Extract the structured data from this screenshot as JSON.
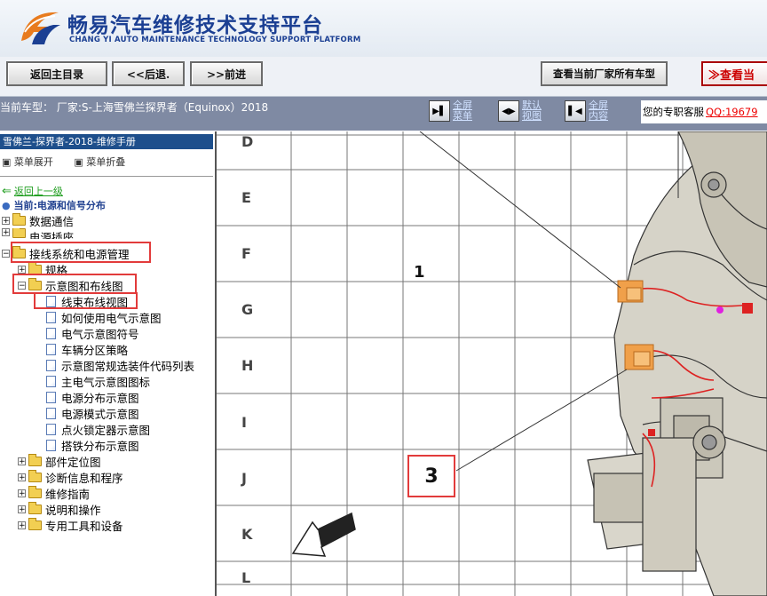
{
  "header": {
    "title": "畅易汽车维修技术支持平台",
    "subtitle": "CHANG YI AUTO MAINTENANCE TECHNOLOGY SUPPORT PLATFORM",
    "brand_color": "#1b3f93"
  },
  "toolbar": {
    "back_main": "返回主目录",
    "back": "<<后退.",
    "forward": ">>前进",
    "view_all_models": "查看当前厂家所有车型",
    "view_current": "≫查看当"
  },
  "infobar": {
    "current_model": "当前车型： 厂家:S-上海雪佛兰探界者（Equinox）2018",
    "view_buttons": [
      {
        "label_line1": "全屏",
        "label_line2": "菜单",
        "icon": "fullscreen-menu-icon"
      },
      {
        "label_line1": "默认",
        "label_line2": "视图",
        "icon": "default-view-icon"
      },
      {
        "label_line1": "全屏",
        "label_line2": "内容",
        "icon": "fullscreen-content-icon"
      }
    ],
    "support_label": "您的专职客服",
    "support_qq": "QQ:19679"
  },
  "sidebar": {
    "manual_title": "雪佛兰-探界者-2018-维修手册",
    "expand_menu": "菜单展开",
    "collapse_menu": "菜单折叠",
    "back_up": "返回上一级",
    "current_location": "当前:电源和信号分布",
    "tree": [
      {
        "label": "数据通信",
        "type": "folder",
        "level": 0,
        "expanded": false
      },
      {
        "label": "电源插座",
        "type": "folder",
        "level": 0,
        "expanded": false
      },
      {
        "label": "接线系统和电源管理",
        "type": "folder",
        "level": 0,
        "expanded": true,
        "highlighted": true
      },
      {
        "label": "规格",
        "type": "folder",
        "level": 1,
        "expanded": false
      },
      {
        "label": "示意图和布线图",
        "type": "folder",
        "level": 1,
        "expanded": true,
        "highlighted": true
      },
      {
        "label": "线束布线视图",
        "type": "doc",
        "level": 2,
        "highlighted": true
      },
      {
        "label": "如何使用电气示意图",
        "type": "doc",
        "level": 2
      },
      {
        "label": "电气示意图符号",
        "type": "doc",
        "level": 2
      },
      {
        "label": "车辆分区策略",
        "type": "doc",
        "level": 2
      },
      {
        "label": "示意图常规选装件代码列表",
        "type": "doc",
        "level": 2
      },
      {
        "label": "主电气示意图图标",
        "type": "doc",
        "level": 2
      },
      {
        "label": "电源分布示意图",
        "type": "doc",
        "level": 2
      },
      {
        "label": "电源模式示意图",
        "type": "doc",
        "level": 2
      },
      {
        "label": "点火锁定器示意图",
        "type": "doc",
        "level": 2
      },
      {
        "label": "搭铁分布示意图",
        "type": "doc",
        "level": 2
      },
      {
        "label": "部件定位图",
        "type": "folder",
        "level": 1,
        "expanded": false
      },
      {
        "label": "诊断信息和程序",
        "type": "folder",
        "level": 1,
        "expanded": false
      },
      {
        "label": "维修指南",
        "type": "folder",
        "level": 1,
        "expanded": false
      },
      {
        "label": "说明和操作",
        "type": "folder",
        "level": 1,
        "expanded": false
      },
      {
        "label": "专用工具和设备",
        "type": "folder",
        "level": 1,
        "expanded": false
      }
    ]
  },
  "diagram": {
    "row_labels": [
      "D",
      "E",
      "F",
      "G",
      "H",
      "I",
      "J",
      "K",
      "L"
    ],
    "callout_main": "3",
    "callout_top": "1"
  }
}
